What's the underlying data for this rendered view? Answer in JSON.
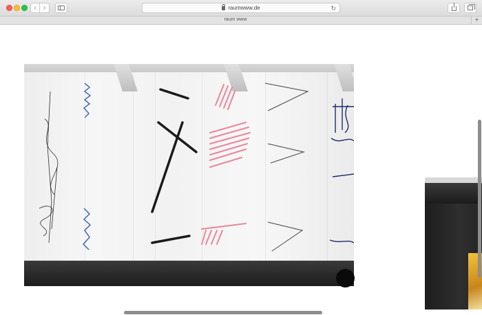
{
  "browser": {
    "url": "raumwww.de",
    "tab_title": "raum www",
    "icons": {
      "back": "chevron-left-icon",
      "forward": "chevron-right-icon",
      "sidebar": "sidebar-icon",
      "lock": "lock-icon",
      "reload": "reload-icon",
      "share": "share-icon",
      "tabs": "tabs-overview-icon",
      "new_tab": "plus-icon"
    },
    "glyphs": {
      "back": "‹",
      "forward": "›",
      "reload": "↻",
      "new_tab": "+"
    }
  },
  "colors": {
    "traffic_red": "#fd5f57",
    "traffic_yellow": "#febc2e",
    "traffic_green": "#28c840",
    "stroke_black": "#1a1a1a",
    "stroke_blue": "#3b5fae",
    "stroke_pink": "#e8879a",
    "stroke_navy": "#1f2b6e"
  }
}
